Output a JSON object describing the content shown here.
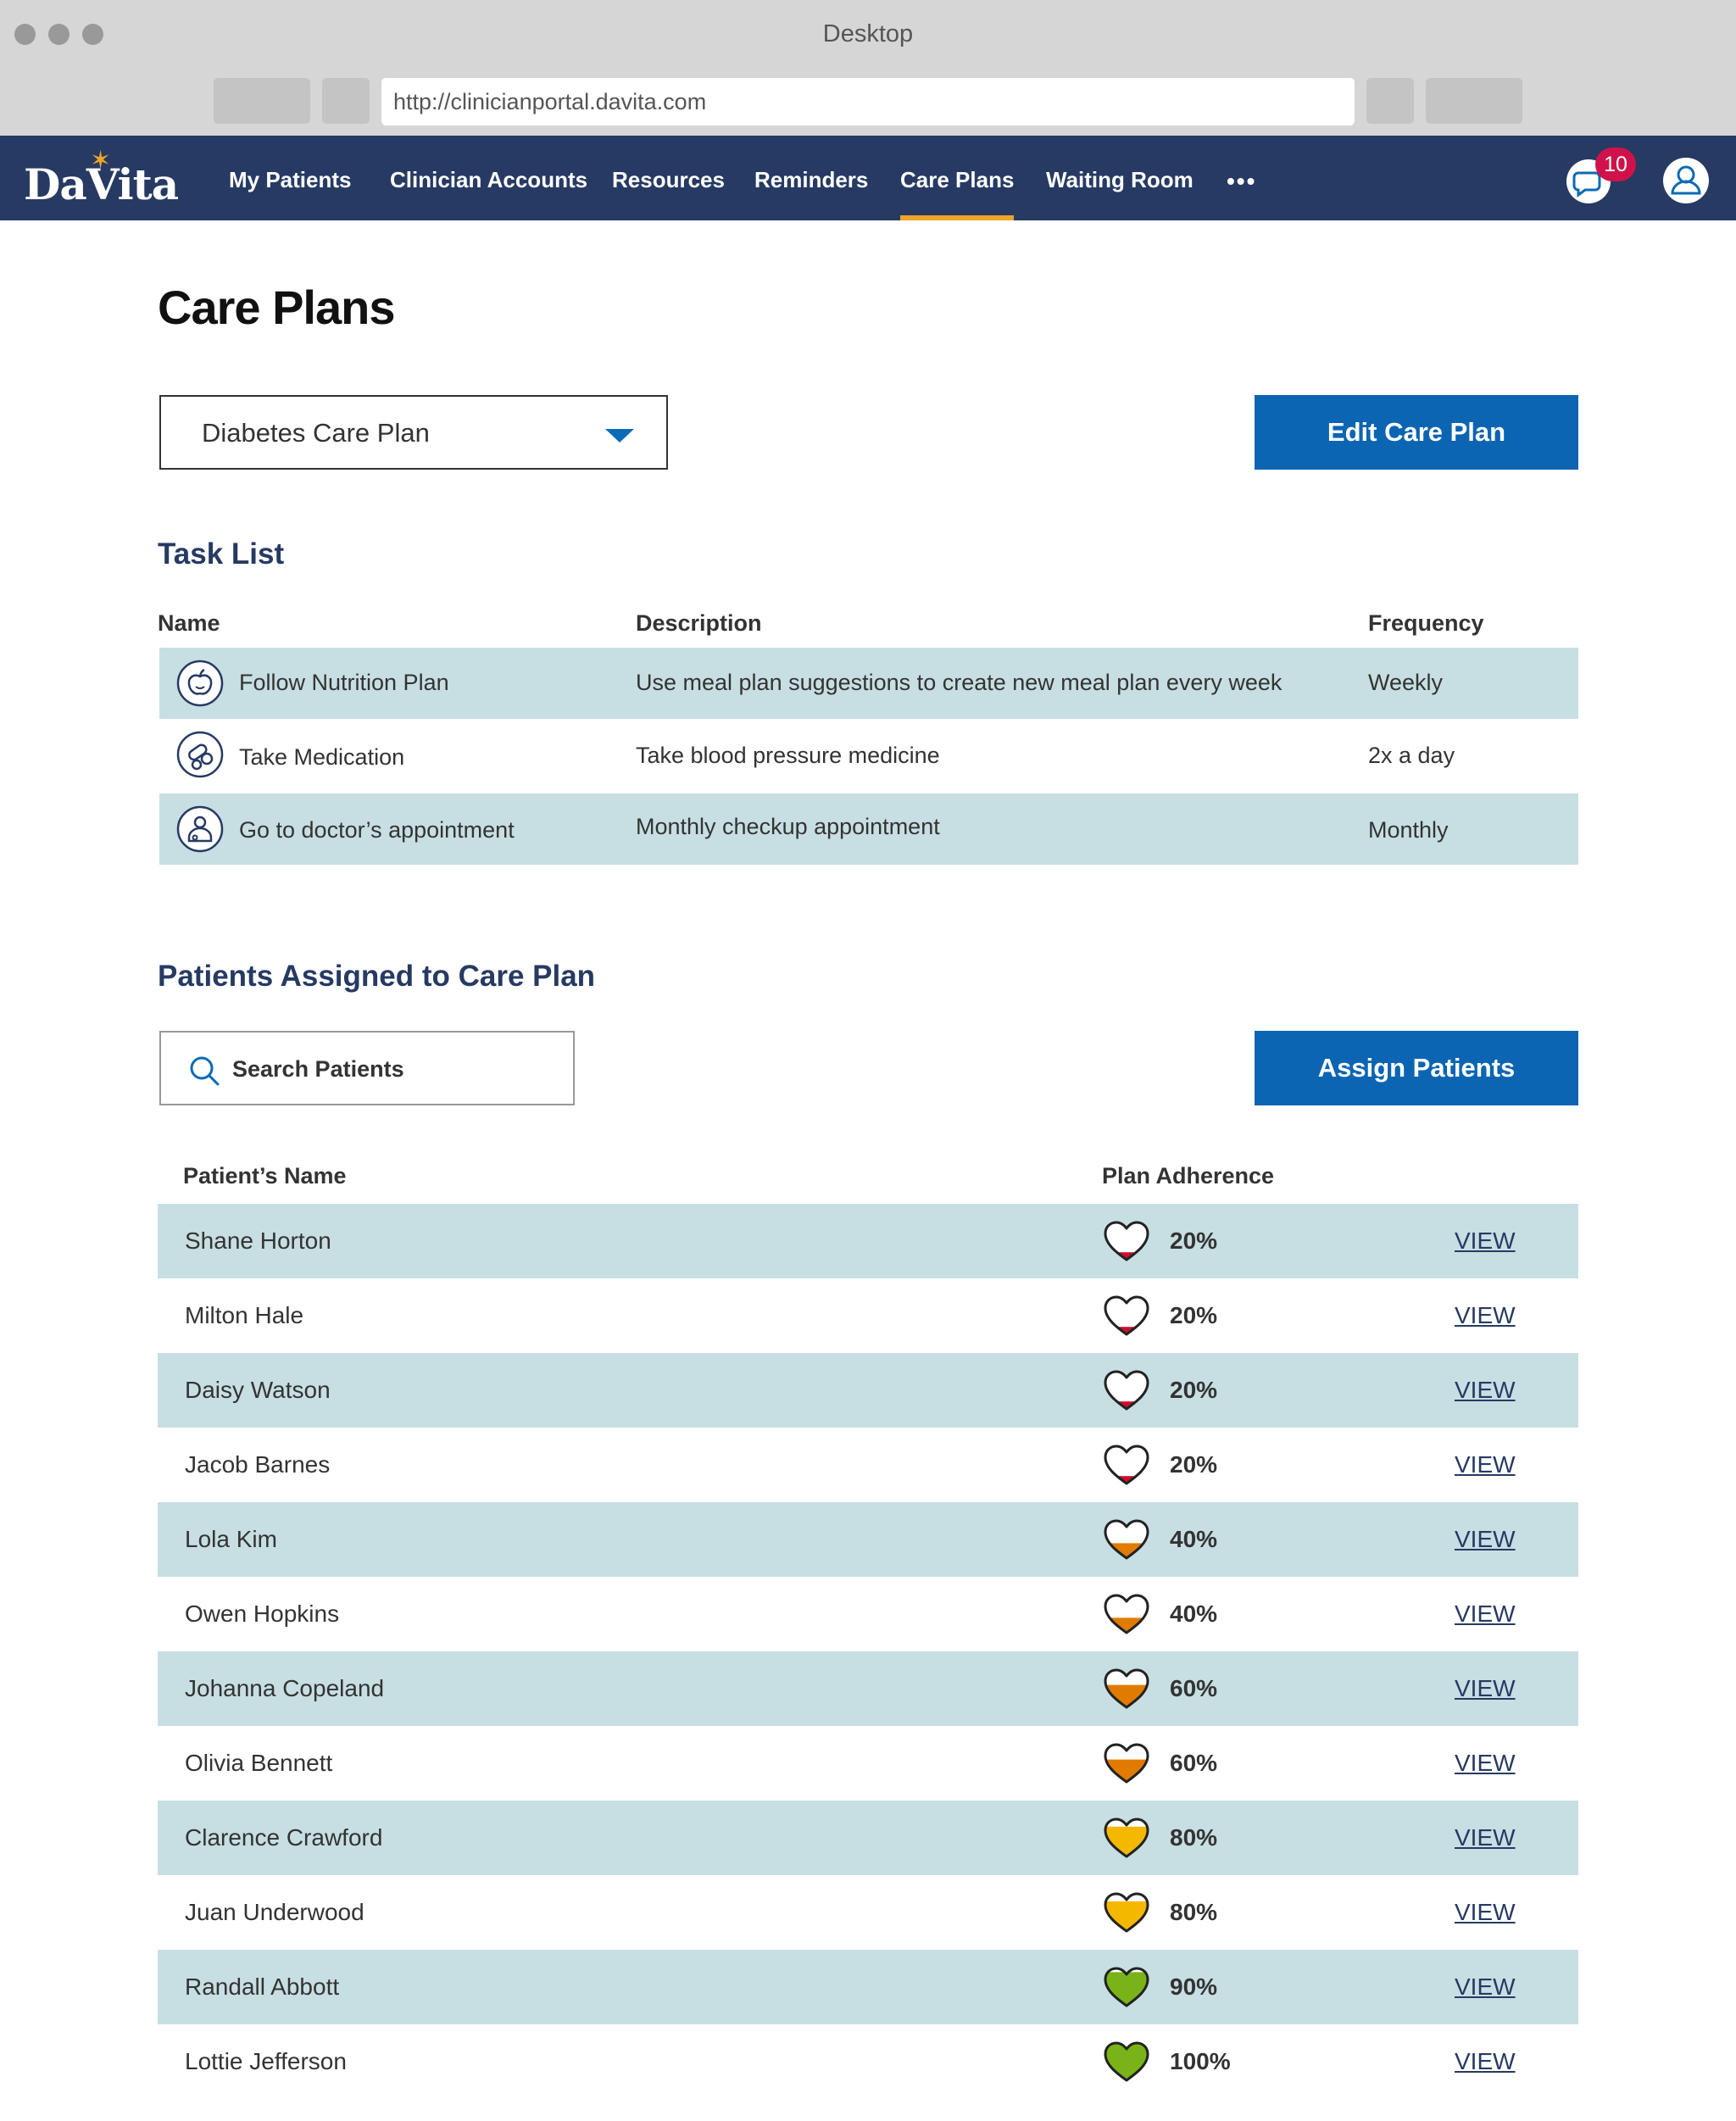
{
  "window": {
    "title": "Desktop",
    "url": "http://clinicianportal.davita.com"
  },
  "header": {
    "logo_text": "DaVita",
    "nav": [
      {
        "label": "My Patients",
        "active": false
      },
      {
        "label": "Clinician Accounts",
        "active": false
      },
      {
        "label": "Resources",
        "active": false
      },
      {
        "label": "Reminders",
        "active": false
      },
      {
        "label": "Care Plans",
        "active": true
      },
      {
        "label": "Waiting Room",
        "active": false
      }
    ],
    "more_label": "•••",
    "notification_count": "10",
    "icons": {
      "chat": "chat-bubble-icon",
      "user": "user-icon",
      "more": "more-dots-icon"
    }
  },
  "page": {
    "title": "Care Plans",
    "selected_plan": "Diabetes Care Plan",
    "edit_button": "Edit Care Plan"
  },
  "task_list": {
    "title": "Task List",
    "columns": [
      "Name",
      "Description",
      "Frequency"
    ],
    "rows": [
      {
        "icon": "apple-icon",
        "name": "Follow Nutrition Plan",
        "description": "Use meal plan suggestions to create new meal plan every week",
        "frequency": "Weekly"
      },
      {
        "icon": "pills-icon",
        "name": "Take Medication",
        "description": "Take blood pressure medicine",
        "frequency": "2x a day"
      },
      {
        "icon": "doctor-icon",
        "name": "Go to doctor’s appointment",
        "description": "Monthly checkup appointment",
        "frequency": "Monthly"
      }
    ]
  },
  "patients": {
    "title": "Patients Assigned to Care Plan",
    "search_placeholder": "Search Patients",
    "assign_button": "Assign Patients",
    "columns": [
      "Patient’s Name",
      "Plan Adherence"
    ],
    "view_label": "VIEW",
    "colors": {
      "20": "#c8102e",
      "40": "#e07b00",
      "60": "#e07b00",
      "80": "#f5b800",
      "90": "#7ab317",
      "100": "#7ab317"
    },
    "rows": [
      {
        "name": "Shane Horton",
        "adherence": 20,
        "adherence_label": "20%"
      },
      {
        "name": "Milton Hale",
        "adherence": 20,
        "adherence_label": "20%"
      },
      {
        "name": "Daisy Watson",
        "adherence": 20,
        "adherence_label": "20%"
      },
      {
        "name": "Jacob Barnes",
        "adherence": 20,
        "adherence_label": "20%"
      },
      {
        "name": "Lola Kim",
        "adherence": 40,
        "adherence_label": "40%"
      },
      {
        "name": "Owen Hopkins",
        "adherence": 40,
        "adherence_label": "40%"
      },
      {
        "name": "Johanna Copeland",
        "adherence": 60,
        "adherence_label": "60%"
      },
      {
        "name": "Olivia Bennett",
        "adherence": 60,
        "adherence_label": "60%"
      },
      {
        "name": "Clarence Crawford",
        "adherence": 80,
        "adherence_label": "80%"
      },
      {
        "name": "Juan Underwood",
        "adherence": 80,
        "adherence_label": "80%"
      },
      {
        "name": "Randall Abbott",
        "adherence": 90,
        "adherence_label": "90%"
      },
      {
        "name": "Lottie Jefferson",
        "adherence": 100,
        "adherence_label": "100%"
      }
    ]
  },
  "theme": {
    "navy": "#263a63",
    "accent": "#f0a32b",
    "primary_button": "#0b65b3",
    "row_shade": "#c7dfe3",
    "badge": "#d0124a"
  }
}
